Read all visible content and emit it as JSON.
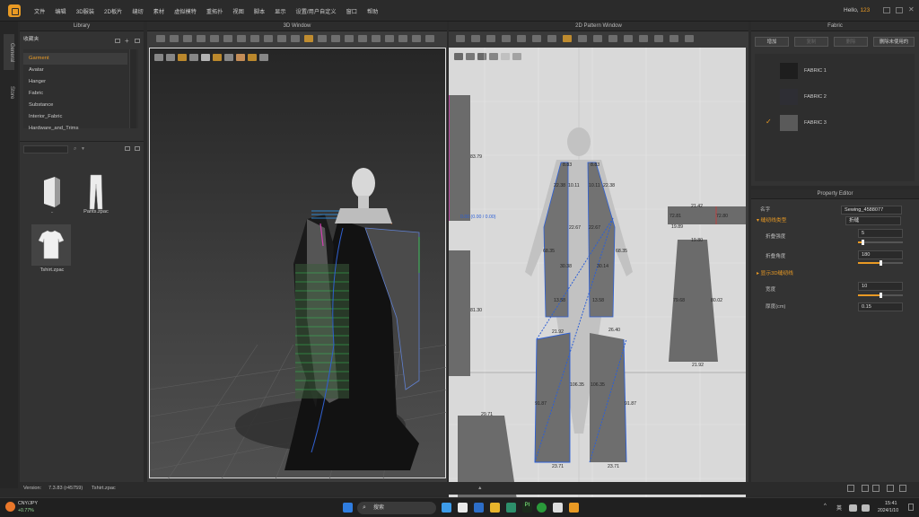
{
  "app": {
    "menu": [
      "文件",
      "编辑",
      "3D服装",
      "2D板片",
      "缝纫",
      "素材",
      "虚拟模特",
      "重拓扑",
      "视图",
      "脚本",
      "显示",
      "设置/用户自定义",
      "窗口",
      "帮助"
    ],
    "hello_prefix": "Hello,",
    "hello_user": "123"
  },
  "left_tabs": [
    "General",
    "Store"
  ],
  "library": {
    "title": "Library",
    "folder_label": "收藏夹",
    "tree": [
      "Garment",
      "Avatar",
      "Hanger",
      "Fabric",
      "Substance",
      "Interior_Fabric",
      "Hardware_and_Trims"
    ],
    "selected": "Garment",
    "thumbs": [
      {
        "caption": ".."
      },
      {
        "caption": "Pants.zpac"
      },
      {
        "caption": "Tshirt.zpac"
      }
    ]
  },
  "window3d": {
    "title": "3D Window"
  },
  "window2d": {
    "title": "2D Pattern Window",
    "measurements": [
      "83.79",
      "0.00 (0.00 / 0.00)",
      "81.30",
      "29.71",
      "8.83",
      "8.83",
      "22.38",
      "10.11",
      "10.11",
      "22.38",
      "22.67",
      "22.67",
      "68.35",
      "68.35",
      "30.38",
      "30.14",
      "13.58",
      "13.58",
      "21.92",
      "26.40",
      "106.35",
      "106.35",
      "91.87",
      "91.87",
      "23.71",
      "23.71",
      "21.42",
      "72.81",
      "19.89",
      "72.80",
      "19.80",
      "79.68",
      "80.02",
      "21.92"
    ],
    "origin_readout": "0.00 (0.00 / 0.00)"
  },
  "fabric": {
    "title": "Fabric",
    "buttons": [
      "增加",
      "复制",
      "删除",
      "删除未使用的"
    ],
    "items": [
      {
        "name": "FABRIC 1",
        "color": "#1e1e1e",
        "checked": false
      },
      {
        "name": "FABRIC 2",
        "color": "#2e2e34",
        "checked": false
      },
      {
        "name": "FABRIC 3",
        "color": "#5a5a5a",
        "checked": true
      }
    ]
  },
  "property": {
    "title": "Property Editor",
    "name_label": "名字",
    "name_value": "Sewing_4588077",
    "section1": "缝纫线类型",
    "type_value": "折缝",
    "fold_strength_label": "折叠强度",
    "fold_strength_value": "5",
    "fold_strength_pct": 10,
    "fold_angle_label": "折叠角度",
    "fold_angle_value": "180",
    "fold_angle_pct": 50,
    "section2": "显示3D缝纫线",
    "width_label": "宽度",
    "width_value": "10",
    "width_pct": 50,
    "thickness_label": "厚度(cm)",
    "thickness_value": "0.15"
  },
  "status": {
    "version_label": "Version:",
    "version_value": "7.3.83 (r45759)",
    "file": "Tshirt.zpac"
  },
  "taskbar": {
    "weather_pair": "CNY/JPY",
    "weather_change": "+0.77%",
    "search": "搜索",
    "ime": "英",
    "time": "15:41",
    "date": "2024/1/10"
  },
  "colors": {
    "accent": "#e99a24",
    "bg": "#2a2a2a",
    "pattern_bg": "#d9d9d9",
    "seam_blue": "#2c5fd6"
  }
}
